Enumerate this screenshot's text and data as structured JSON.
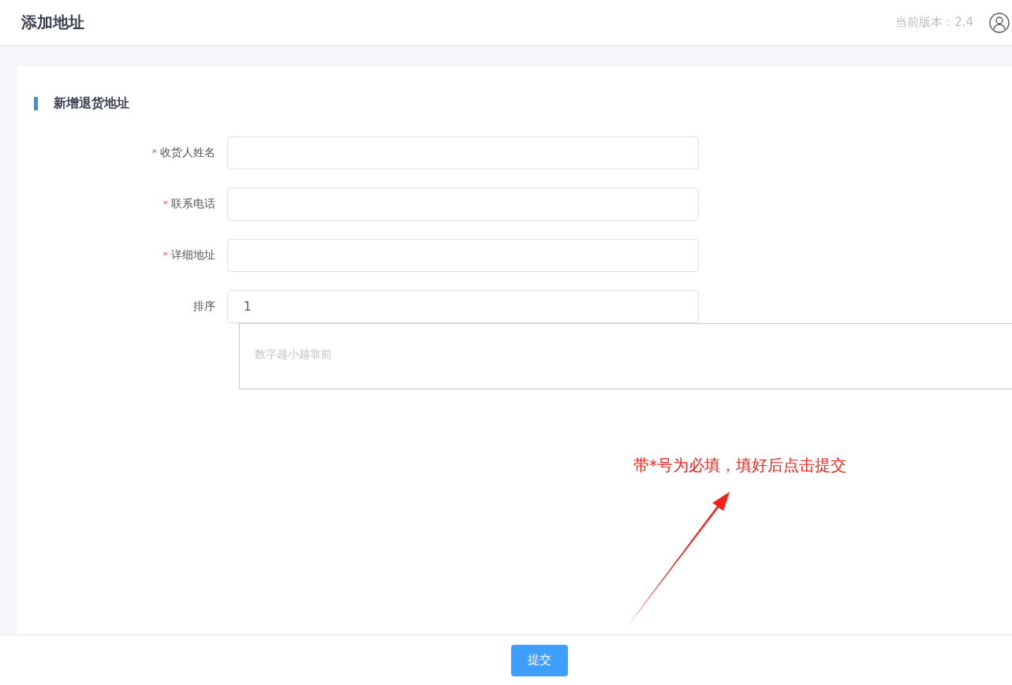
{
  "header": {
    "title": "添加地址",
    "version": "当前版本：2.4"
  },
  "section": {
    "title": "新增退货地址"
  },
  "form": {
    "required_mark": "*",
    "fields": [
      {
        "label": "收货人姓名",
        "required": true
      },
      {
        "label": "联系电话",
        "required": true
      },
      {
        "label": "详细地址",
        "required": true
      },
      {
        "label": "排序",
        "required": false,
        "value": "1"
      }
    ],
    "hint": {
      "placeholder": "数字越小越靠前"
    }
  },
  "annotation": {
    "text": "带*号为必填，填好后点击提交"
  },
  "footer": {
    "submit": "提交"
  }
}
